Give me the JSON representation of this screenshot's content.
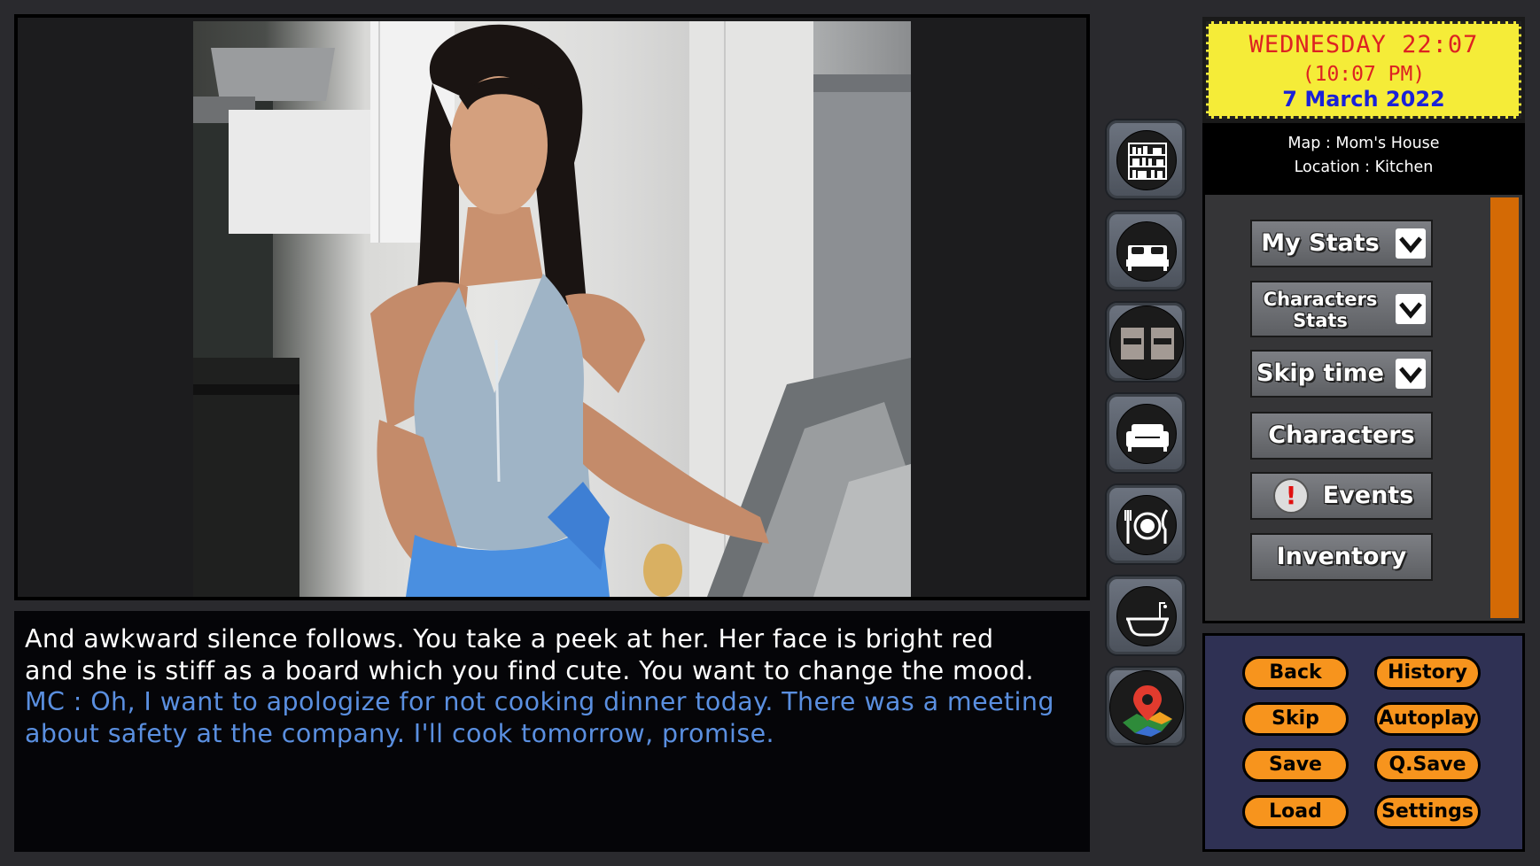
{
  "clock": {
    "day_time": "WEDNESDAY 22:07",
    "time_12h": "(10:07 PM)",
    "date": "7 March 2022"
  },
  "location": {
    "map_line": "Map : Mom's House",
    "location_line": "Location : Kitchen"
  },
  "dialogue": {
    "narration": "And awkward silence follows. You take a peek at her. Her face is bright red\nand she is stiff as a board which you find cute. You want to change the mood.",
    "speech": "MC : Oh, I want to apologize for not cooking dinner today. There was a meeting\nabout safety at the company. I'll cook tomorrow, promise."
  },
  "location_buttons": [
    {
      "icon": "bookshelf-icon"
    },
    {
      "icon": "bed-icon"
    },
    {
      "icon": "twin-beds-icon"
    },
    {
      "icon": "sofa-icon"
    },
    {
      "icon": "dining-plate-icon"
    },
    {
      "icon": "bathtub-icon"
    },
    {
      "icon": "map-pin-icon"
    }
  ],
  "menu": {
    "my_stats": "My Stats",
    "characters_stats_line1": "Characters",
    "characters_stats_line2": "Stats",
    "skip_time": "Skip time",
    "characters": "Characters",
    "events": "Events",
    "events_alert": "!",
    "inventory": "Inventory"
  },
  "controls": {
    "back": "Back",
    "history": "History",
    "skip": "Skip",
    "autoplay": "Autoplay",
    "save": "Save",
    "qsave": "Q.Save",
    "load": "Load",
    "settings": "Settings"
  },
  "colors": {
    "clock_bg": "#f5ec38",
    "clock_red": "#dd2222",
    "clock_blue": "#1a21d8",
    "speech_blue": "#5a8fe0",
    "orange": "#f7941d",
    "scrollbar": "#d46a05",
    "controls_bg": "#2f3154"
  }
}
